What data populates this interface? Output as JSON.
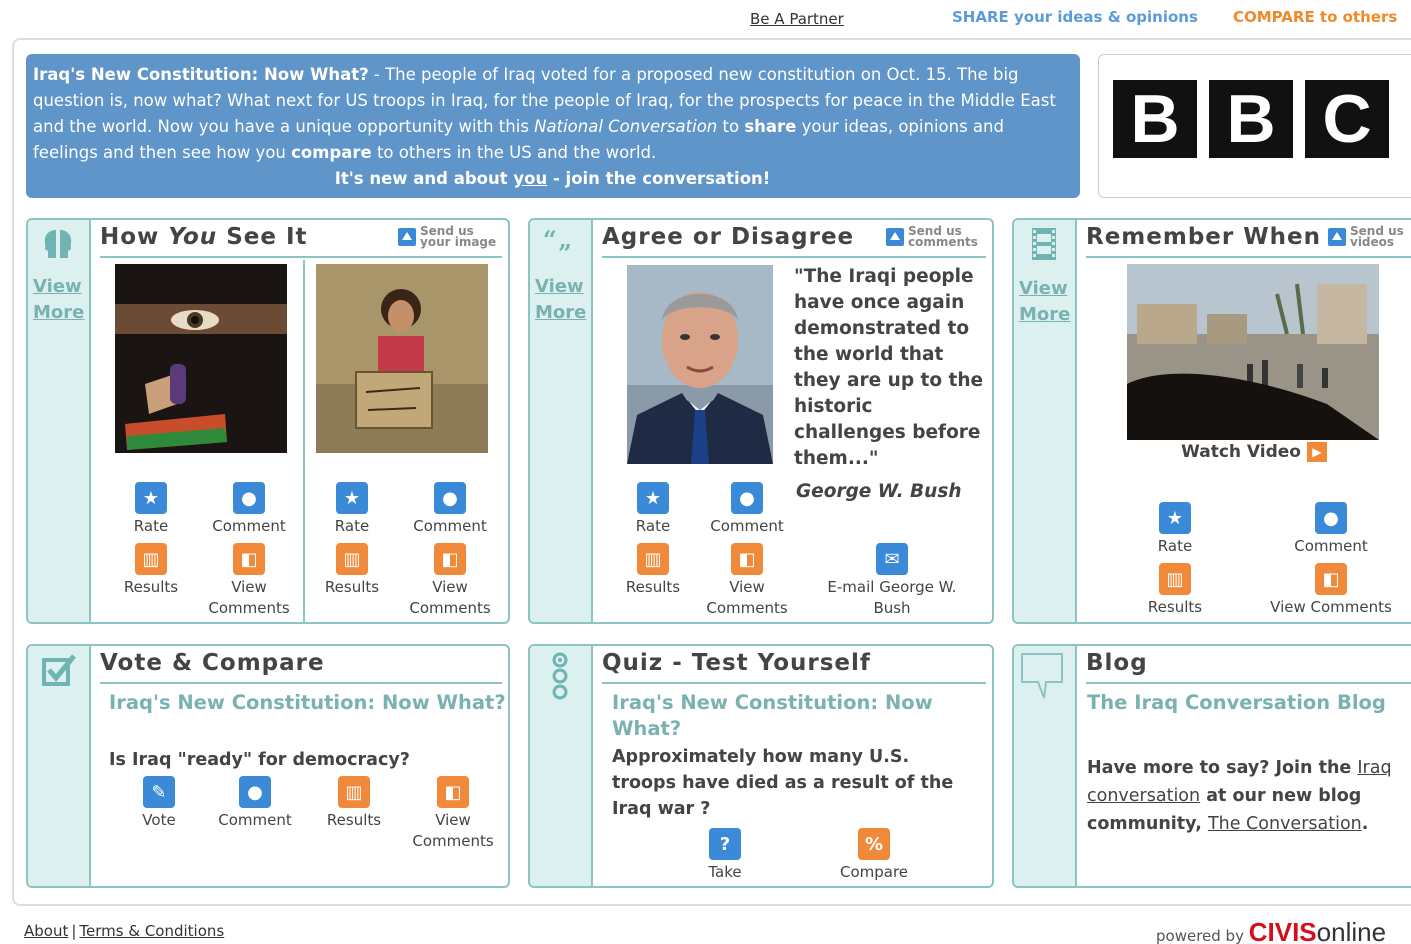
{
  "top": {
    "partner_link": "Be A Partner",
    "share_text": "SHARE your ideas & opinions",
    "compare_text": "COMPARE to others"
  },
  "intro": {
    "heading": "Iraq's New Constitution: Now What?",
    "body_1": " - The people of Iraq voted for a proposed new constitution on Oct. 15. The big question is, now what? What next for US troops in Iraq, for the people of Iraq, for the prospects for peace in the Middle East and the world. Now you have a unique opportunity with this ",
    "body_em": "National Conversation",
    "body_2": " to ",
    "body_share": "share",
    "body_3": " your ideas, opinions and feelings and then see how you ",
    "body_compare": "compare",
    "body_4": " to others in the US and the world.",
    "cta_1": "It's new and about ",
    "cta_you": "you",
    "cta_2": " - join the conversation!"
  },
  "sponsor": {
    "letters": [
      "B",
      "B",
      "C"
    ]
  },
  "panels": {
    "see_it": {
      "title_1": "How ",
      "title_em": "You",
      "title_2": " See It",
      "send_1": "Send us",
      "send_2": "your image",
      "view": "View",
      "more": "More",
      "actions": {
        "rate": "Rate",
        "comment": "Comment",
        "results": "Results",
        "view": "View",
        "comments": "Comments"
      }
    },
    "agree": {
      "title": "Agree or Disagree",
      "send_1": "Send us",
      "send_2": "comments",
      "view": "View",
      "more": "More",
      "quote_lines": [
        "\"The Iraqi people",
        "have once again",
        "demonstrated to",
        "the world that",
        "they are up to the",
        "historic",
        "challenges before",
        "them...\""
      ],
      "author": "George W. Bush",
      "actions": {
        "rate": "Rate",
        "comment": "Comment",
        "results": "Results",
        "view": "View",
        "comments": "Comments",
        "email_1": "E-mail George W.",
        "email_2": "Bush"
      }
    },
    "remember": {
      "title": "Remember When",
      "send_1": "Send us",
      "send_2": "videos",
      "view": "View",
      "more": "More",
      "watch": "Watch Video",
      "actions": {
        "rate": "Rate",
        "comment": "Comment",
        "results": "Results",
        "view_comments": "View Comments"
      }
    },
    "vote": {
      "title": "Vote & Compare",
      "subtitle": "Iraq's New Constitution: Now What?",
      "question": "Is Iraq \"ready\" for democracy?",
      "actions": {
        "vote": "Vote",
        "comment": "Comment",
        "results": "Results",
        "view": "View",
        "comments": "Comments"
      }
    },
    "quiz": {
      "title": "Quiz - Test Yourself",
      "subtitle_1": "Iraq's New Constitution: Now",
      "subtitle_2": "What?",
      "question_1": "Approximately how many U.S.",
      "question_2": "troops have died as a result of the",
      "question_3": "Iraq war ?",
      "take": "Take",
      "compare": "Compare"
    },
    "blog": {
      "title": "Blog",
      "subtitle": "The Iraq Conversation Blog",
      "line_1a": "Have more to say? Join the ",
      "line_1_link": "Iraq",
      "line_2_link": "conversation",
      "line_2b": " at our new blog",
      "line_3a": "community, ",
      "line_3_link": "The Conversation",
      "line_3b": "."
    }
  },
  "footer": {
    "about": "About",
    "separator": "|",
    "terms": "Terms & Conditions",
    "powered": "powered by",
    "brand_1": "CIVIS",
    "brand_2": "online"
  }
}
